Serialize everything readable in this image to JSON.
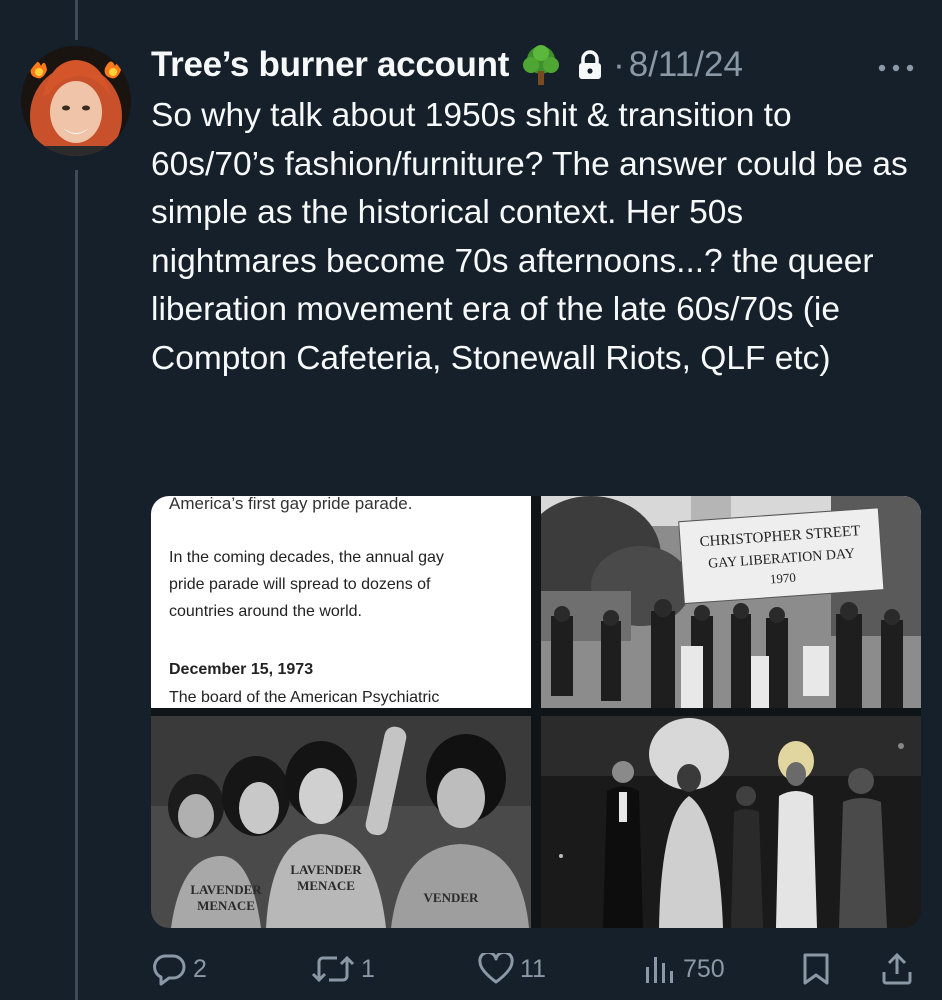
{
  "tweet": {
    "author_name": "Tree’s burner account",
    "name_emoji": "🌳",
    "lock_icon": "lock-icon",
    "separator": "·",
    "date": "8/11/24",
    "more_icon": "more-horizontal-icon",
    "text": "So why talk about 1950s shit & transition to 60s/70’s fashion/furniture? The answer could be as simple as the historical context. Her 50s nightmares become 70s afternoons...? the queer liberation movement era of the late 60s/70s (ie Compton Cafeteria, Stonewall Riots, QLF etc)"
  },
  "media": {
    "doc": {
      "top_line": "America’s first gay pride parade.",
      "para_line_1": "In the coming decades, the annual gay",
      "para_line_2": "pride parade will spread to dozens of",
      "para_line_3": "countries around the world.",
      "date_heading": "December 15, 1973",
      "last_line": "The board of the American Psychiatric"
    },
    "parade_banner": {
      "line1": "CHRISTOPHER STREET",
      "line2": "GAY LIBERATION DAY",
      "line3": "1970"
    },
    "shirts": {
      "shirt1_a": "LAVENDER",
      "shirt1_b": "MENACE",
      "shirt2_a": "LAVENDER",
      "shirt2_b": "MENACE",
      "shirt3": "VENDER"
    }
  },
  "actions": {
    "reply_count": "2",
    "repost_count": "1",
    "like_count": "11",
    "views_count": "750"
  },
  "colors": {
    "background": "#15202b",
    "text": "#f7f9f9",
    "muted": "#8b98a5"
  }
}
